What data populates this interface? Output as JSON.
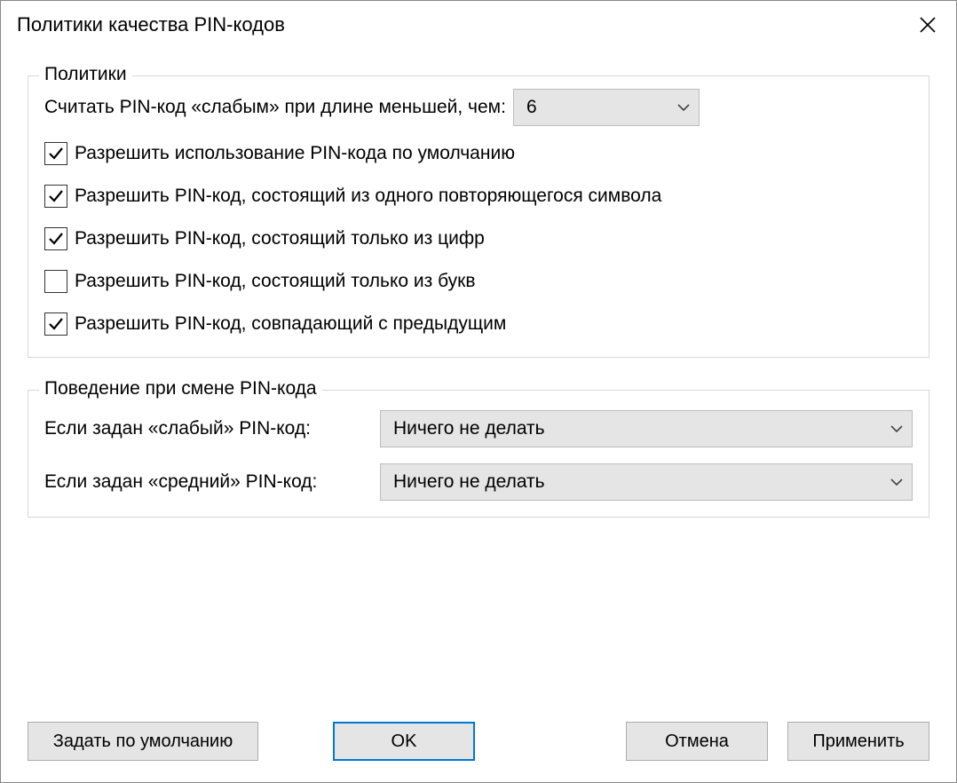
{
  "window": {
    "title": "Политики качества PIN-кодов"
  },
  "policies": {
    "legend": "Политики",
    "weak_label": "Считать PIN-код «слабым» при длине меньшей, чем:",
    "weak_value": "6",
    "checkboxes": [
      {
        "label": "Разрешить использование PIN-кода по умолчанию",
        "checked": true
      },
      {
        "label": "Разрешить PIN-код, состоящий из одного повторяющегося символа",
        "checked": true
      },
      {
        "label": "Разрешить PIN-код, состоящий только из цифр",
        "checked": true
      },
      {
        "label": "Разрешить PIN-код, состоящий только из букв",
        "checked": false
      },
      {
        "label": "Разрешить PIN-код, совпадающий с предыдущим",
        "checked": true
      }
    ]
  },
  "behavior": {
    "legend": "Поведение при смене PIN-кода",
    "weak_row_label": "Если задан «слабый» PIN-код:",
    "weak_row_value": "Ничего не делать",
    "medium_row_label": "Если задан «средний» PIN-код:",
    "medium_row_value": "Ничего не делать"
  },
  "buttons": {
    "defaults": "Задать по умолчанию",
    "ok": "OK",
    "cancel": "Отмена",
    "apply": "Применить"
  }
}
